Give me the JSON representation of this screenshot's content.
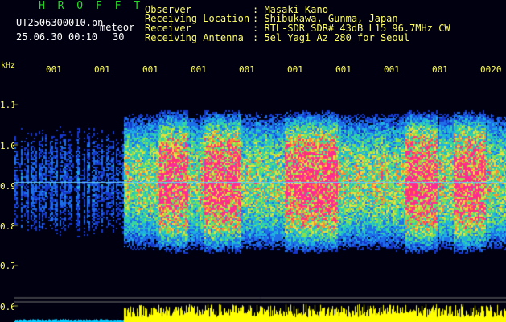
{
  "header": {
    "brand": "H R O F F T",
    "filename": "UT2506300010.pn",
    "meteor_label": "meteor",
    "datetime": "25.06.30 00:10",
    "count": "30",
    "fields": {
      "observer_label": "Observer",
      "observer": ": Masaki Kano",
      "location_label": "Receiving Location",
      "location": ": Shibukawa, Gunma, Japan",
      "receiver_label": "Receiver",
      "receiver": ": RTL-SDR SDR# 43dB L15 96.7MHz CW",
      "antenna_label": "Receiving Antenna",
      "antenna": ": 5el Yagi Az 280 for Seoul"
    }
  },
  "axis": {
    "unit": "kHz",
    "time_ticks": [
      "001",
      "001",
      "001",
      "001",
      "001",
      "001",
      "001",
      "001",
      "001",
      "0020"
    ],
    "freq_ticks": [
      "1.1",
      "1.0",
      "0.9",
      "0.8",
      "0.7",
      "0.6"
    ]
  },
  "colors": {
    "background": "#000011",
    "label": "#ffff66",
    "brand": "#22dd22",
    "trace": "#ffff00",
    "baseline": "#00ccff"
  }
}
